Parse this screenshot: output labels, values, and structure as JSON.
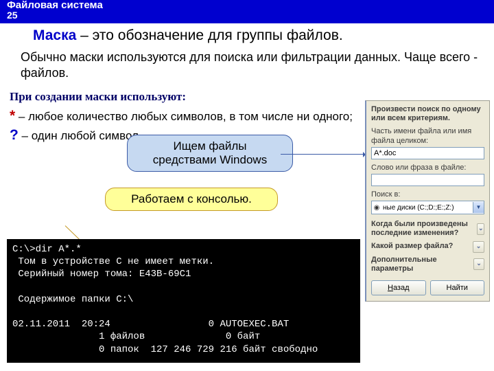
{
  "header": {
    "title": "Файловая система",
    "slide_no": "25"
  },
  "title": {
    "strong": "Маска",
    "rest": " – это обозначение для группы файлов."
  },
  "para1": "Обычно маски используются для поиска или фильтрации данных. Чаще всего - файлов.",
  "subhead": "При создании маски используют:",
  "mask_lines": {
    "line1_sym": "*",
    "line1_txt": " – любое количество любых символов, в том числе ни одного;",
    "line2_sym": "?",
    "line2_txt": " – один любой символ."
  },
  "callouts": {
    "c1_line1": "Ищем файлы",
    "c1_line2": "средствами Windows",
    "c2": "Работаем с консолью."
  },
  "console": "C:\\>dir A*.*\n Том в устройстве C не имеет метки.\n Серийный номер тома: E43B-69C1\n\n Содержимое папки C:\\\n\n02.11.2011  20:24                 0 AUTOEXEC.BAT\n               1 файлов              0 байт\n               0 папок  127 246 729 216 байт свободно\n\nC:\\>_",
  "panel": {
    "group_title": "Произвести поиск по одному или всем критериям.",
    "filename_label": "Часть имени файла или имя файла целиком:",
    "filename_value": "A*.doc",
    "phrase_label": "Слово или фраза в файле:",
    "phrase_value": "",
    "lookin_label": "Поиск в:",
    "lookin_value": "ные диски (C:;D:;E:;Z:)",
    "exp1": "Когда были произведены последние изменения?",
    "exp2": "Какой размер файла?",
    "exp3": "Дополнительные параметры",
    "btn_back_u": "Н",
    "btn_back_rest": "азад",
    "btn_find": "Найти"
  }
}
